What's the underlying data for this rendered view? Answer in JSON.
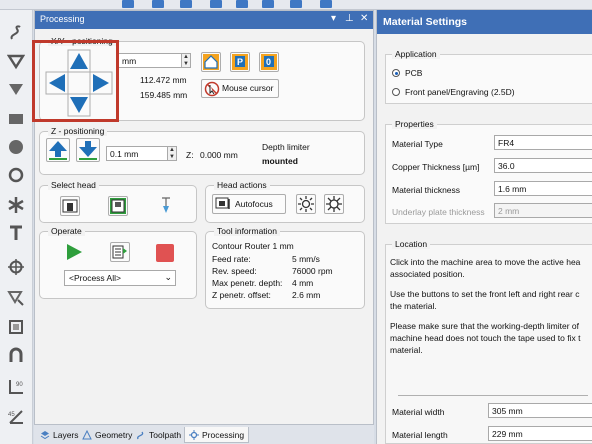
{
  "processing_panel": {
    "title": "Processing",
    "xy_positioning": {
      "label": "X/Y - positioning",
      "step_value": "mm",
      "x_value": "112.472 mm",
      "y_value": "159.485 mm",
      "mouse_cursor_label": "Mouse cursor"
    },
    "z_positioning": {
      "label": "Z - positioning",
      "step_value": "0.1 mm",
      "z_label": "Z:",
      "z_value": "0.000 mm",
      "depth_limiter_label": "Depth limiter",
      "depth_limiter_status": "mounted"
    },
    "select_head": {
      "label": "Select head"
    },
    "head_actions": {
      "label": "Head actions",
      "autofocus_label": "Autofocus"
    },
    "operate": {
      "label": "Operate",
      "process_select_value": "<Process All>"
    },
    "tool_information": {
      "label": "Tool information",
      "tool_name": "Contour Router 1 mm",
      "rows": [
        {
          "key": "Feed rate:",
          "value": "5 mm/s"
        },
        {
          "key": "Rev. speed:",
          "value": "76000 rpm"
        },
        {
          "key": "Max penetr. depth:",
          "value": "4 mm"
        },
        {
          "key": "Z penetr. offset:",
          "value": "2.6 mm"
        }
      ]
    }
  },
  "bottom_tabs": [
    {
      "label": "Layers"
    },
    {
      "label": "Geometry"
    },
    {
      "label": "Toolpath"
    },
    {
      "label": "Processing"
    }
  ],
  "material_panel": {
    "title": "Material Settings",
    "application": {
      "label": "Application",
      "options": [
        "PCB",
        "Front panel/Engraving (2.5D)"
      ],
      "selected": "PCB"
    },
    "properties": {
      "label": "Properties",
      "material_type_label": "Material Type",
      "material_type_value": "FR4",
      "copper_thickness_label": "Copper Thickness [µm]",
      "copper_thickness_value": "36.0",
      "material_thickness_label": "Material thickness",
      "material_thickness_value": "1.6 mm",
      "underlay_label": "Underlay plate thickness",
      "underlay_value": "2 mm"
    },
    "location": {
      "label": "Location",
      "para1_line1": "Click into the machine area to move the active hea",
      "para1_line2": "associated position.",
      "para2_line1": "Use the buttons to set the front left and right rear c",
      "para2_line2": "the material.",
      "para3_line1": "Please make sure that the working-depth limiter of",
      "para3_line2": "machine head does not touch the tape used to fix t",
      "para3_line3": "material."
    },
    "material_width_label": "Material width",
    "material_width_value": "305 mm",
    "material_length_label": "Material length",
    "material_length_value": "229 mm"
  },
  "colors": {
    "title_bar": "#3f6fb6",
    "arrow_blue": "#1f6fb8",
    "highlight_red": "#c0392b",
    "play_green": "#2e9e3c",
    "stop_red": "#e05252"
  }
}
